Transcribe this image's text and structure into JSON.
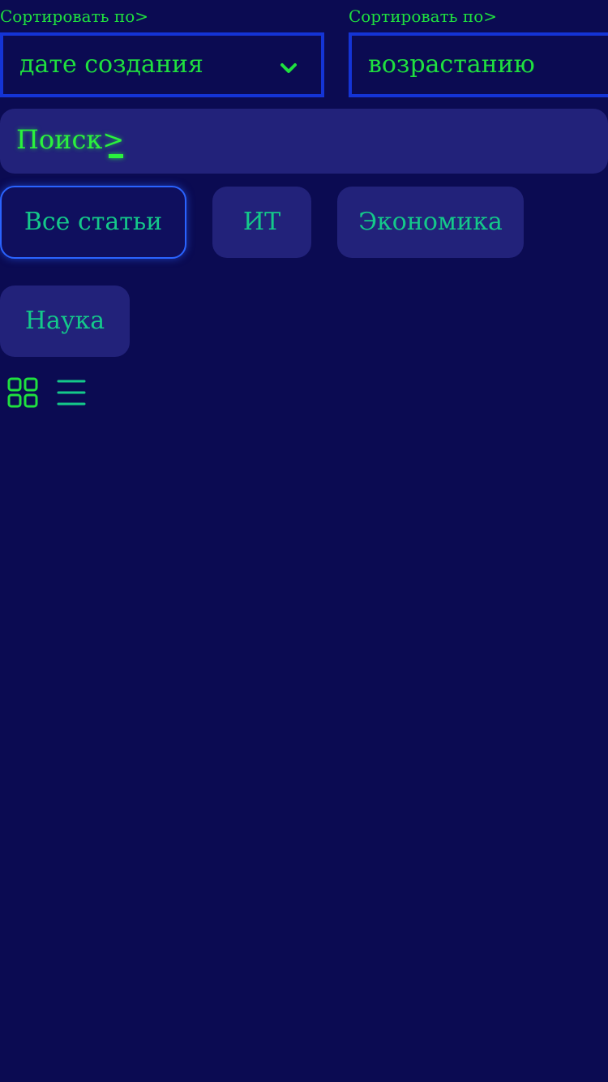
{
  "sort_field": {
    "label": "Сортировать по>",
    "value": "дате создания",
    "icon": "chevron-down-icon"
  },
  "sort_order": {
    "label": "Сортировать по>",
    "value": "возрастанию"
  },
  "search": {
    "label": "Поиск>",
    "value": ""
  },
  "categories": [
    {
      "label": "Все статьи",
      "active": true
    },
    {
      "label": "ИТ",
      "active": false
    },
    {
      "label": "Экономика",
      "active": false
    },
    {
      "label": "Наука",
      "active": false
    }
  ],
  "view_toggles": {
    "grid_icon": "grid-view-icon",
    "list_icon": "list-view-icon"
  },
  "colors": {
    "background": "#0b0b52",
    "panel": "#22227a",
    "accent_text": "#1fe03f",
    "chip_text": "#14c98a",
    "border_blue": "#1434d6",
    "active_border": "#2a63ff"
  }
}
